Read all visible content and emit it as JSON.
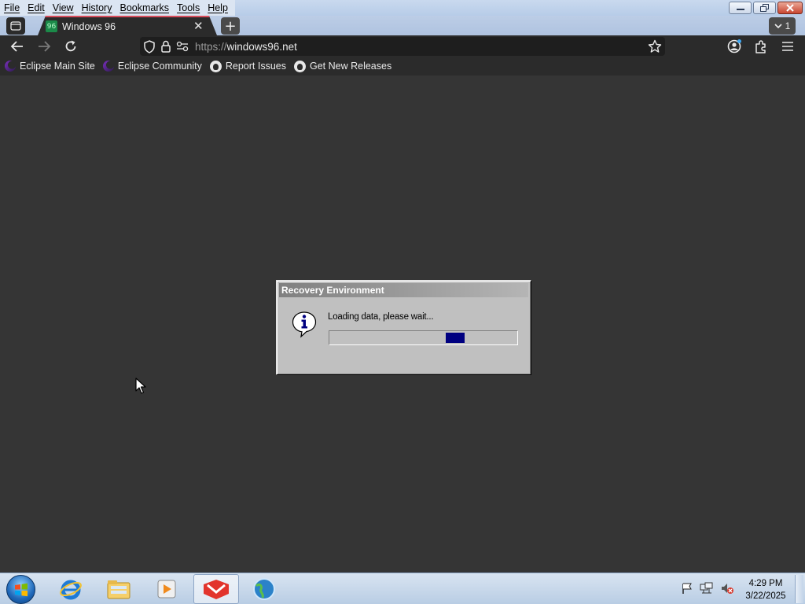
{
  "menubar": {
    "items": [
      "File",
      "Edit",
      "View",
      "History",
      "Bookmarks",
      "Tools",
      "Help"
    ]
  },
  "tabs": {
    "active_title": "Windows 96",
    "tab_count": "1"
  },
  "navbar": {
    "url_scheme": "https://",
    "url_host": "windows96.net"
  },
  "bookmarks": [
    {
      "label": "Eclipse Main Site",
      "icon": "eclipse-icon"
    },
    {
      "label": "Eclipse Community",
      "icon": "eclipse-icon"
    },
    {
      "label": "Report Issues",
      "icon": "github-icon"
    },
    {
      "label": "Get New Releases",
      "icon": "github-icon"
    }
  ],
  "dialog": {
    "title": "Recovery Environment",
    "message": "Loading data, please wait...",
    "icon": "info-icon",
    "progress_fraction": 0.69
  },
  "taskbar": {
    "apps": [
      "internet-explorer-icon",
      "file-explorer-icon",
      "media-player-icon",
      "browser-app-icon",
      "globe-app-icon"
    ],
    "tray_icons": [
      "action-center-flag-icon",
      "network-icon",
      "volume-muted-icon"
    ],
    "time": "4:29 PM",
    "date": "3/22/2025"
  },
  "colors": {
    "page_background": "#353535",
    "toolbar_dark": "#2b2b2b",
    "progress_fill": "#000080",
    "dialog_face": "#c0c0c0",
    "tab_accent": "#d94c5b"
  }
}
